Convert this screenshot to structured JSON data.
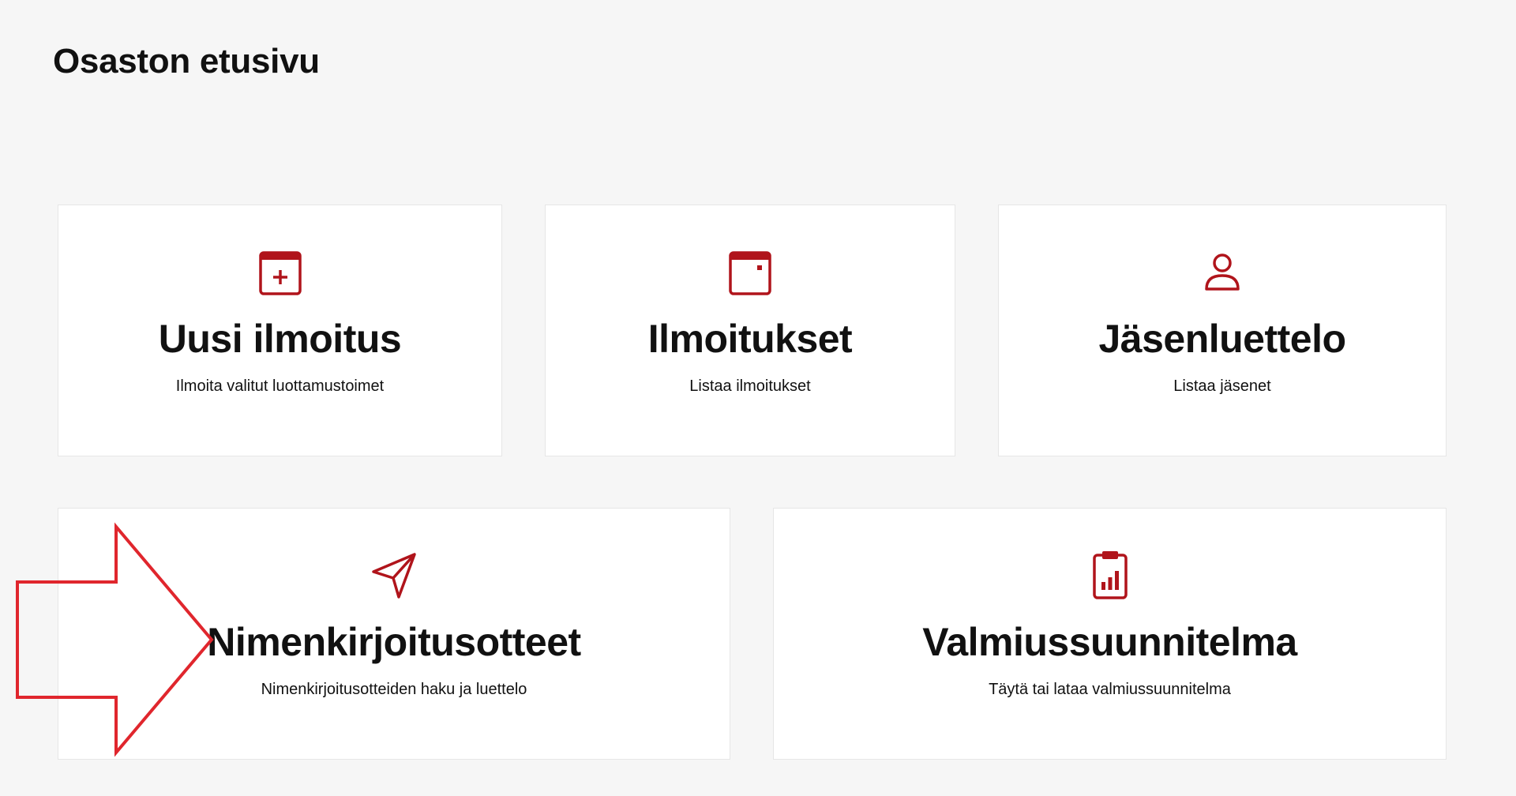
{
  "page": {
    "title": "Osaston etusivu"
  },
  "colors": {
    "accent": "#b0141b",
    "annotation_arrow": "#e0262d",
    "background": "#f6f6f6",
    "card": "#ffffff"
  },
  "cards": [
    {
      "icon": "calendar-plus-icon",
      "title": "Uusi ilmoitus",
      "description": "Ilmoita valitut luottamustoimet"
    },
    {
      "icon": "calendar-icon",
      "title": "Ilmoitukset",
      "description": "Listaa ilmoitukset"
    },
    {
      "icon": "user-icon",
      "title": "Jäsenluettelo",
      "description": "Listaa jäsenet"
    },
    {
      "icon": "paper-plane-icon",
      "title": "Nimenkirjoitusotteet",
      "description": "Nimenkirjoitusotteiden haku ja luettelo"
    },
    {
      "icon": "clipboard-chart-icon",
      "title": "Valmiussuunnitelma",
      "description": "Täytä tai lataa valmiussuunnitelma"
    }
  ],
  "annotation": {
    "icon": "arrow-right-icon"
  }
}
